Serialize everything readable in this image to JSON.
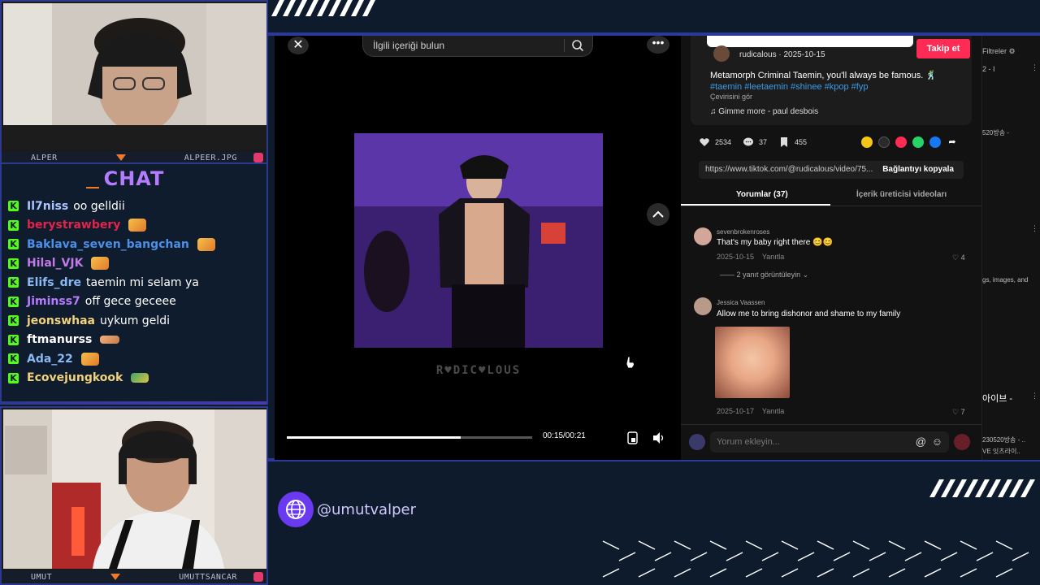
{
  "cams": {
    "top": {
      "left_label": "ALPER",
      "right_label": "ALPEER.JPG"
    },
    "bottom": {
      "left_label": "UMUT",
      "right_label": "UMUTTSANCAR"
    }
  },
  "chat": {
    "title": "CHAT",
    "messages": [
      {
        "user": "Il7niss",
        "color": "#a9c6ff",
        "text": "oo gelldii",
        "emote": ""
      },
      {
        "user": "berystrawbery",
        "color": "#e0254a",
        "text": "",
        "emote": "face"
      },
      {
        "user": "Baklava_seven_bangchan",
        "color": "#4c8fe8",
        "text": "",
        "emote": "face"
      },
      {
        "user": "Hilal_VJK",
        "color": "#c07be8",
        "text": "",
        "emote": "face"
      },
      {
        "user": "Elifs_dre",
        "color": "#8ab8f2",
        "text": "taemin mi selam ya",
        "emote": ""
      },
      {
        "user": "Jiminss7",
        "color": "#b57cff",
        "text": "off gece geceee",
        "emote": ""
      },
      {
        "user": "jeonswhaa",
        "color": "#f2d27a",
        "text": "uykum geldi",
        "emote": ""
      },
      {
        "user": "ftmanurss",
        "color": "#ffffff",
        "text": "",
        "emote": "hands"
      },
      {
        "user": "Ada_22",
        "color": "#8ab8f2",
        "text": "",
        "emote": "face"
      },
      {
        "user": "Ecovejungkook",
        "color": "#f2d27a",
        "text": "",
        "emote": "car"
      }
    ]
  },
  "video": {
    "search_placeholder": "İlgili içeriği bulun",
    "watermark": "R♥DIC♥LOUS",
    "time": "00:15/00:21",
    "progress": 0.71
  },
  "post": {
    "author": "rudicalous · 2025-10-15",
    "follow_label": "Takip et",
    "caption": "Metamorph Criminal Taemin, you'll always be famous. 🕺",
    "hashtags": "#taemin #leetaemin #shinee #kpop #fyp",
    "translate": "Çevirisini gör",
    "music": "♫  Gimme more - paul desbois",
    "likes": "2534",
    "comments": "37",
    "saves": "455",
    "link": "https://www.tiktok.com/@rudicalous/video/75...",
    "copy_label": "Bağlantıyı kopyala"
  },
  "tabs": {
    "comments": "Yorumlar (37)",
    "creator": "İçerik üreticisi videoları"
  },
  "comments": [
    {
      "user": "sevenbrokenroses",
      "text": "That's my baby right there 😊😊",
      "date": "2025-10-15",
      "reply": "Yanıtla",
      "likes": "4",
      "replies": "2 yanıt görüntüleyin ⌄"
    },
    {
      "user": "Jessica Vaassen",
      "text": "Allow me to bring dishonor and shame to my family",
      "date": "2025-10-17",
      "reply": "Yanıtla",
      "likes": "7"
    }
  ],
  "comment_input": {
    "placeholder": "Yorum ekleyin..."
  },
  "far_right": {
    "filters": "Filtreler",
    "t1": "2 - I",
    "t2": "520방송 -",
    "t3": "gs, images, and",
    "t4": "아이브 -",
    "t5": "230520방송 - ..",
    "t6": "VE 잇츠라이.."
  },
  "handle": "@umutvalper"
}
